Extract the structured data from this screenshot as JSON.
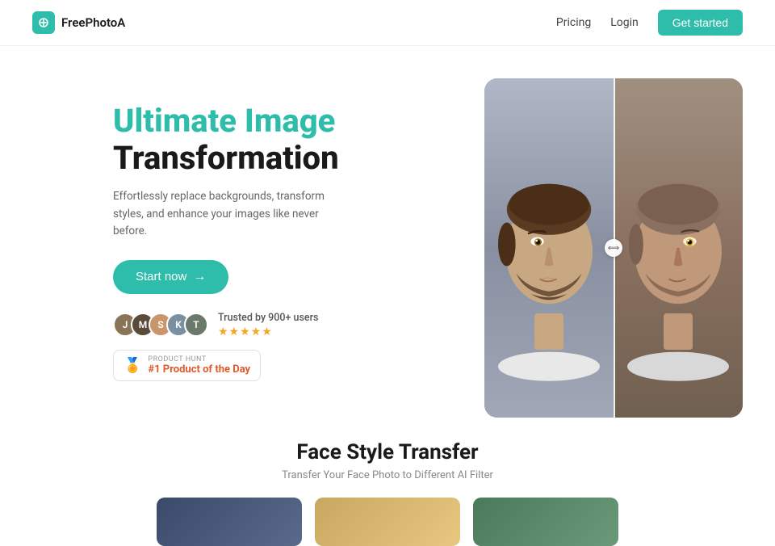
{
  "nav": {
    "logo_text": "FreePhotoA",
    "pricing_label": "Pricing",
    "login_label": "Login",
    "get_started_label": "Get started"
  },
  "hero": {
    "title_colored": "Ultimate Image",
    "title_black": "Transformation",
    "subtitle": "Effortlessly replace backgrounds, transform styles, and enhance your images like never before.",
    "start_btn_label": "Start now",
    "start_btn_arrow": "→",
    "trust_text": "Trusted by 900+ users",
    "stars": "★★★★★",
    "ph_label": "PRODUCT HUNT",
    "ph_rank": "#1 Product of the Day"
  },
  "bottom": {
    "title": "Face Style Transfer",
    "subtitle": "Transfer Your Face Photo to Different AI Filter"
  }
}
